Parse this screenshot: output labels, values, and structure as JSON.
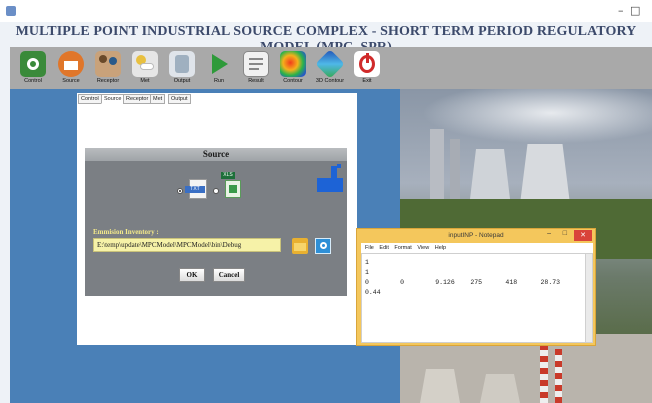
{
  "window": {
    "minimize_glyph": "–",
    "maximize_glyph": "□"
  },
  "app_title": "MULTIPLE POINT INDUSTRIAL SOURCE COMPLEX - SHORT TERM PERIOD REGULATORY MODEL (MPC_SPR)",
  "toolbar": {
    "buttons": [
      {
        "label": "Control",
        "icon": "gear-icon",
        "color": "#3a8a3a"
      },
      {
        "label": "Source",
        "icon": "factory-icon",
        "color": "#e0762a"
      },
      {
        "label": "Receptor",
        "icon": "people-icon",
        "color": "#8a6a4a"
      },
      {
        "label": "Met",
        "icon": "weather-icon",
        "color": "#e8c040"
      },
      {
        "label": "Output",
        "icon": "database-icon",
        "color": "#8a9aa8"
      },
      {
        "label": "Run",
        "icon": "play-icon",
        "color": "#2e9a3a"
      },
      {
        "label": "Result",
        "icon": "document-icon",
        "color": "#8a8a8a"
      },
      {
        "label": "Contour",
        "icon": "contour-icon",
        "color": "#d0402a"
      },
      {
        "label": "3D Contour",
        "icon": "3d-contour-icon",
        "color": "#2a7ad0"
      },
      {
        "label": "Exit",
        "icon": "power-icon",
        "color": "#d02a2a"
      }
    ]
  },
  "tabs": [
    "Control",
    "Source",
    "Receptor",
    "Met",
    "Output"
  ],
  "active_tab": "Source",
  "source_dialog": {
    "title": "Source",
    "options": [
      {
        "label": "TXT",
        "selected": true
      },
      {
        "label": "XLS",
        "selected": false
      }
    ],
    "emission_label": "Emmision Inventory :",
    "path_value": "E:\\temp\\update\\MPCModel\\MPCModel\\bin\\Debug",
    "ok_label": "OK",
    "cancel_label": "Cancel"
  },
  "notepad": {
    "title": "inputINP - Notepad",
    "menu": [
      "File",
      "Edit",
      "Format",
      "View",
      "Help"
    ],
    "lines": [
      "1",
      "1",
      "0        0        9.126    275      418      28.73",
      "0.44"
    ],
    "close_glyph": "✕",
    "min_glyph": "–",
    "max_glyph": "□"
  }
}
